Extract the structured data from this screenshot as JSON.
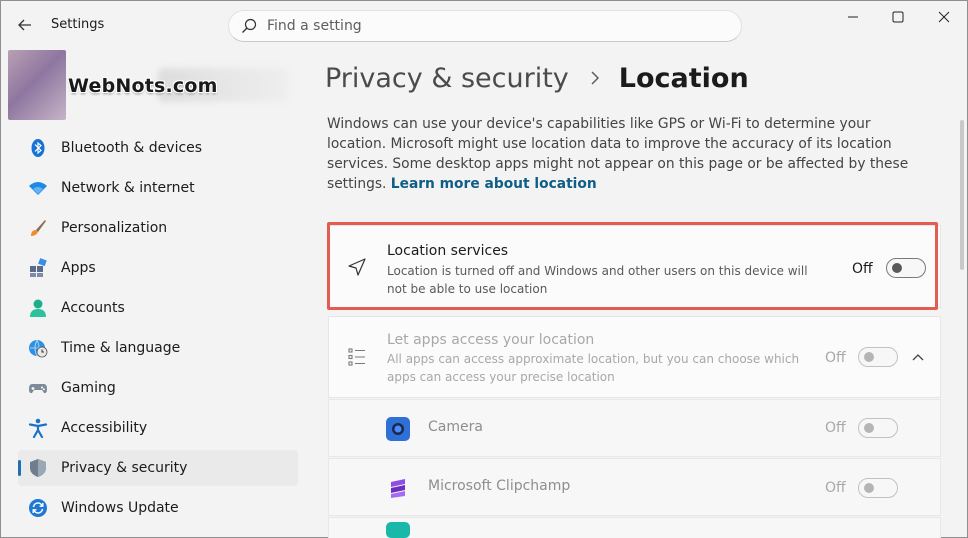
{
  "window": {
    "title": "Settings",
    "search_placeholder": "Find a setting"
  },
  "profile": {
    "watermark": "WebNots.com"
  },
  "sidebar": {
    "items": [
      {
        "label": "Bluetooth & devices",
        "icon": "bluetooth-icon"
      },
      {
        "label": "Network & internet",
        "icon": "wifi-icon"
      },
      {
        "label": "Personalization",
        "icon": "brush-icon"
      },
      {
        "label": "Apps",
        "icon": "apps-icon"
      },
      {
        "label": "Accounts",
        "icon": "person-icon"
      },
      {
        "label": "Time & language",
        "icon": "globe-clock-icon"
      },
      {
        "label": "Gaming",
        "icon": "gamepad-icon"
      },
      {
        "label": "Accessibility",
        "icon": "accessibility-icon"
      },
      {
        "label": "Privacy & security",
        "icon": "shield-icon",
        "active": true
      },
      {
        "label": "Windows Update",
        "icon": "update-icon"
      }
    ]
  },
  "main": {
    "breadcrumb_parent": "Privacy & security",
    "breadcrumb_current": "Location",
    "description": "Windows can use your device's capabilities like GPS or Wi-Fi to determine your location. Microsoft might use location data to improve the accuracy of its location services. Some desktop apps might not appear on this page or be affected by these settings.",
    "learn_more": "Learn more about location",
    "location_services": {
      "title": "Location services",
      "subtitle": "Location is turned off and Windows and other users on this device will not be able to use location",
      "state": "Off"
    },
    "apps_access": {
      "title": "Let apps access your location",
      "subtitle": "All apps can access approximate location, but you can choose which apps can access your precise location",
      "state": "Off"
    },
    "apps": [
      {
        "name": "Camera",
        "state": "Off",
        "color": "#2f6fd8"
      },
      {
        "name": "Microsoft Clipchamp",
        "state": "Off",
        "color": "#7b3fd6"
      }
    ]
  },
  "colors": {
    "accent": "#1f6fb5",
    "highlight_border": "#e25c52",
    "link": "#0f5e86"
  }
}
